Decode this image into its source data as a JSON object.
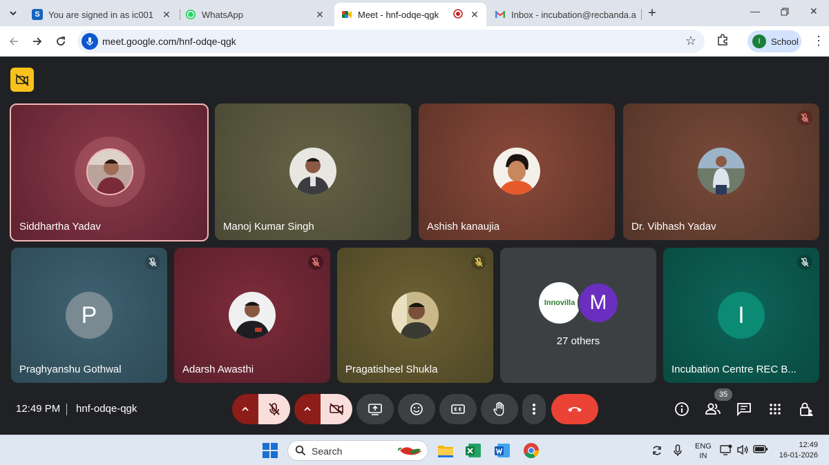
{
  "browser": {
    "tabs": [
      {
        "title": "You are signed in as ic001",
        "icon": "s-app-icon",
        "active": false
      },
      {
        "title": "WhatsApp",
        "icon": "whatsapp-icon",
        "active": false
      },
      {
        "title": "Meet - hnf-odqe-qgk",
        "icon": "meet-icon",
        "active": true,
        "recording": true
      },
      {
        "title": "Inbox - incubation@recbanda.a",
        "icon": "gmail-icon",
        "active": false
      }
    ],
    "url": "meet.google.com/hnf-odqe-qgk",
    "profile": {
      "initial": "I",
      "label": "School"
    }
  },
  "meeting": {
    "time": "12:49 PM",
    "code": "hnf-odqe-qgk",
    "participant_count": "35",
    "participants": [
      {
        "name": "Siddhartha Yadav",
        "speaking": true,
        "muted": false
      },
      {
        "name": "Manoj Kumar Singh",
        "muted": false
      },
      {
        "name": "Ashish kanaujia",
        "muted": false
      },
      {
        "name": "Dr. Vibhash Yadav",
        "muted": true
      },
      {
        "name": "Praghyanshu Gothwal",
        "initial": "P",
        "muted": true
      },
      {
        "name": "Adarsh Awasthi",
        "muted": true
      },
      {
        "name": "Pragatisheel Shukla",
        "muted": true
      },
      {
        "name": "Incubation Centre REC B...",
        "initial": "I",
        "muted": true
      }
    ],
    "others": {
      "label": "27 others",
      "logo_text": "Innovilla",
      "initial": "M"
    },
    "controls": {
      "mic_muted": true,
      "camera_off": true
    },
    "colors": {
      "leave": "#ea4335",
      "muted_toggle": "#f9dedc",
      "speaking_border": "#f2b8b5"
    }
  },
  "taskbar": {
    "search": "Search",
    "lang": {
      "line1": "ENG",
      "line2": "IN"
    },
    "time": "12:49",
    "date": "16-01-2026"
  }
}
